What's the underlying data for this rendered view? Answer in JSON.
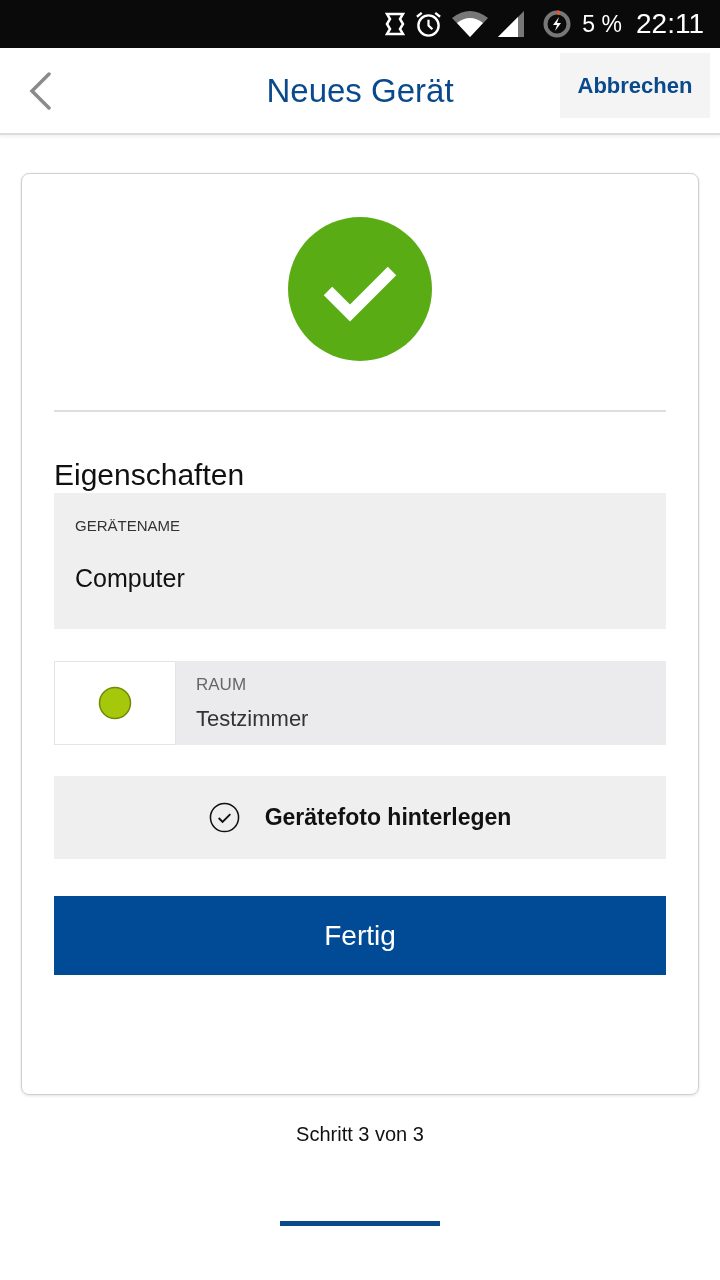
{
  "status_bar": {
    "battery": "5 %",
    "time": "22:11"
  },
  "header": {
    "title": "Neues Gerät",
    "cancel": "Abbrechen"
  },
  "section_title": "Eigenschaften",
  "fields": [
    {
      "kind": "text",
      "label": "GERÄTENAME",
      "value": "Computer"
    },
    {
      "kind": "room",
      "label": "RAUM",
      "value": "Testzimmer",
      "color": "#a6c80a"
    }
  ],
  "photo_button": {
    "label": "Gerätefoto hinterlegen"
  },
  "primary_button": {
    "label": "Fertig"
  },
  "step": "Schritt 3 von 3"
}
